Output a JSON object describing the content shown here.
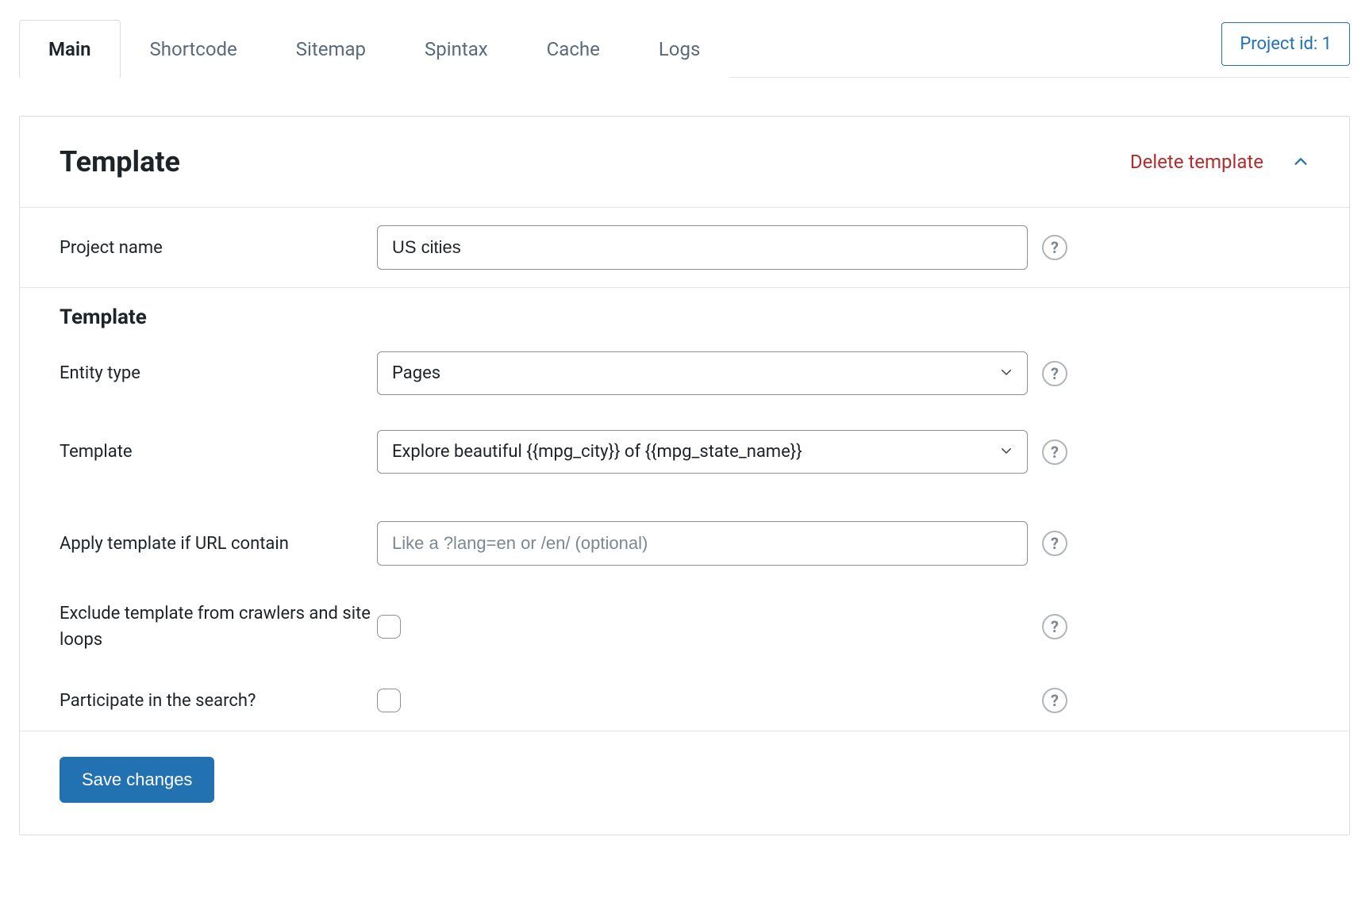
{
  "tabs": {
    "items": [
      "Main",
      "Shortcode",
      "Sitemap",
      "Spintax",
      "Cache",
      "Logs"
    ],
    "active_index": 0
  },
  "project_id_label": "Project id: 1",
  "panel": {
    "title": "Template",
    "delete_label": "Delete template"
  },
  "fields": {
    "project_name": {
      "label": "Project name",
      "value": "US cities"
    },
    "section_subtitle": "Template",
    "entity_type": {
      "label": "Entity type",
      "value": "Pages"
    },
    "template": {
      "label": "Template",
      "value": "Explore beautiful {{mpg_city}} of {{mpg_state_name}}"
    },
    "apply_if_url": {
      "label": "Apply template if URL contain",
      "placeholder": "Like a ?lang=en or /en/ (optional)",
      "value": ""
    },
    "exclude_crawlers": {
      "label": "Exclude template from crawlers and site loops",
      "checked": false
    },
    "participate_search": {
      "label": "Participate in the search?",
      "checked": false
    }
  },
  "actions": {
    "save_label": "Save changes"
  }
}
